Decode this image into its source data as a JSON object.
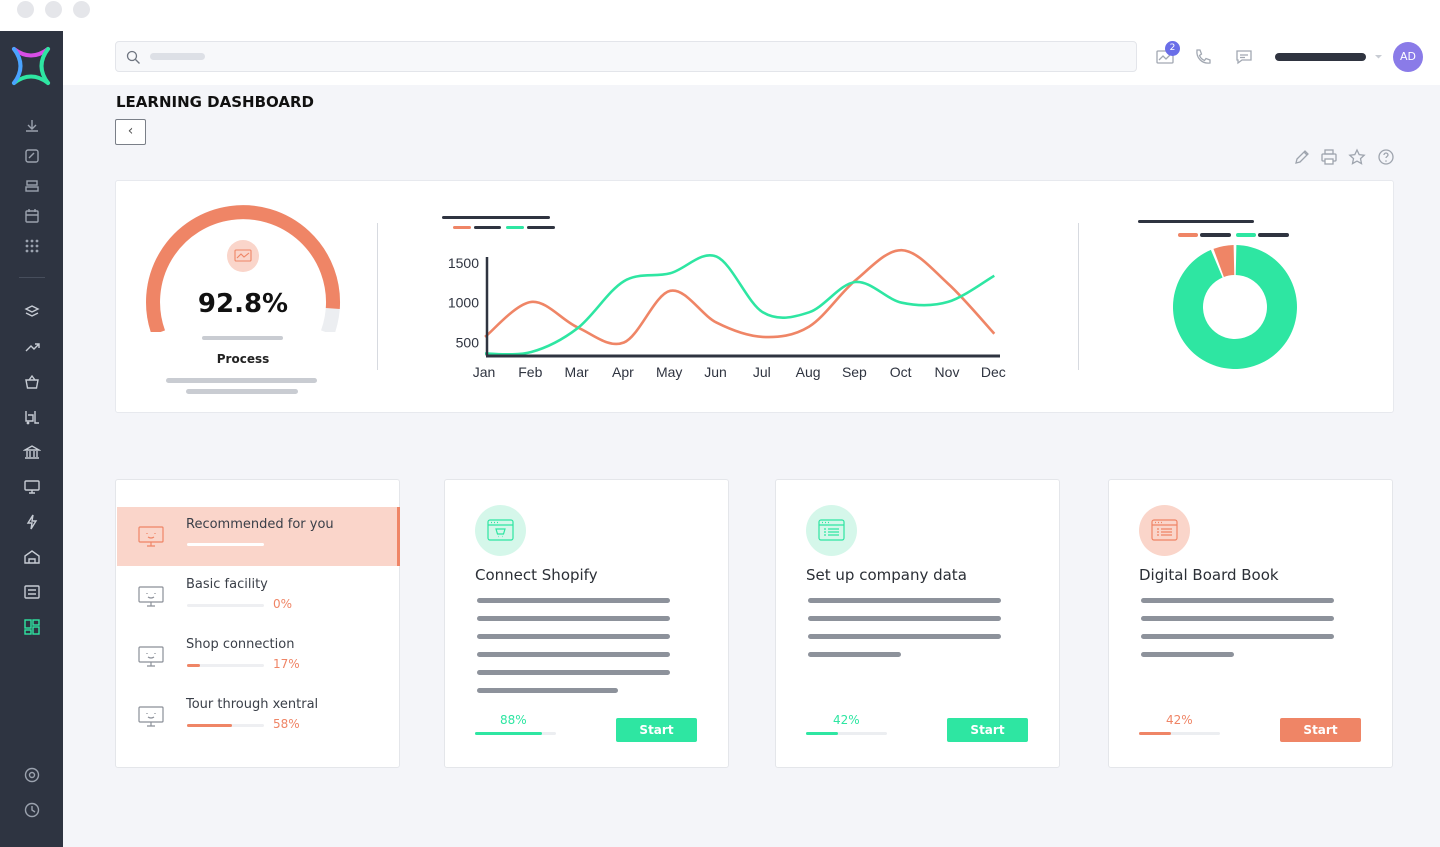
{
  "window": {
    "title_dots": 3
  },
  "header": {
    "notification_count": "2",
    "avatar_initials": "AD"
  },
  "page": {
    "title": "LEARNING DASHBOARD"
  },
  "gauge": {
    "value": "92.8%",
    "label": "Process",
    "fraction": 0.928
  },
  "chart_data": [
    {
      "type": "line",
      "title": "",
      "x": [
        "Jan",
        "Feb",
        "Mar",
        "Apr",
        "May",
        "Jun",
        "Jul",
        "Aug",
        "Sep",
        "Oct",
        "Nov",
        "Dec"
      ],
      "y_ticks": [
        500,
        1000,
        1500
      ],
      "ylim": [
        330,
        1650
      ],
      "grid": false,
      "series": [
        {
          "color": "#ef8566",
          "values": [
            570,
            1010,
            690,
            500,
            1150,
            750,
            570,
            700,
            1280,
            1660,
            1240,
            610
          ]
        },
        {
          "color": "#2ee6a2",
          "values": [
            360,
            380,
            680,
            1270,
            1370,
            1580,
            880,
            880,
            1260,
            1000,
            1010,
            1340
          ]
        }
      ]
    },
    {
      "type": "pie",
      "title": "",
      "slices": [
        {
          "value": 94,
          "color": "#2ee6a2"
        },
        {
          "value": 6,
          "color": "#ef8566"
        }
      ]
    }
  ],
  "recommendations": {
    "items": [
      {
        "title": "Recommended for you",
        "pct": "",
        "progress": 0,
        "active": true
      },
      {
        "title": "Basic facility",
        "pct": "0%",
        "progress": 0,
        "active": false
      },
      {
        "title": "Shop connection",
        "pct": "17%",
        "progress": 17,
        "active": false
      },
      {
        "title": "Tour through xentral",
        "pct": "58%",
        "progress": 58,
        "active": false
      }
    ]
  },
  "tasks": [
    {
      "title": "Connect Shopify",
      "pct": "88%",
      "progress": 88,
      "button": "Start",
      "color": "#2ee6a2",
      "icon_bg": "#d5f7ea",
      "icon": "shop-window-icon"
    },
    {
      "title": "Set up company data",
      "pct": "42%",
      "progress": 42,
      "button": "Start",
      "color": "#2ee6a2",
      "icon_bg": "#d5f7ea",
      "icon": "document-list-icon"
    },
    {
      "title": "Digital Board Book",
      "pct": "42%",
      "progress": 42,
      "button": "Start",
      "color": "#ef8566",
      "icon_bg": "#fad5ca",
      "icon": "book-list-icon"
    }
  ]
}
